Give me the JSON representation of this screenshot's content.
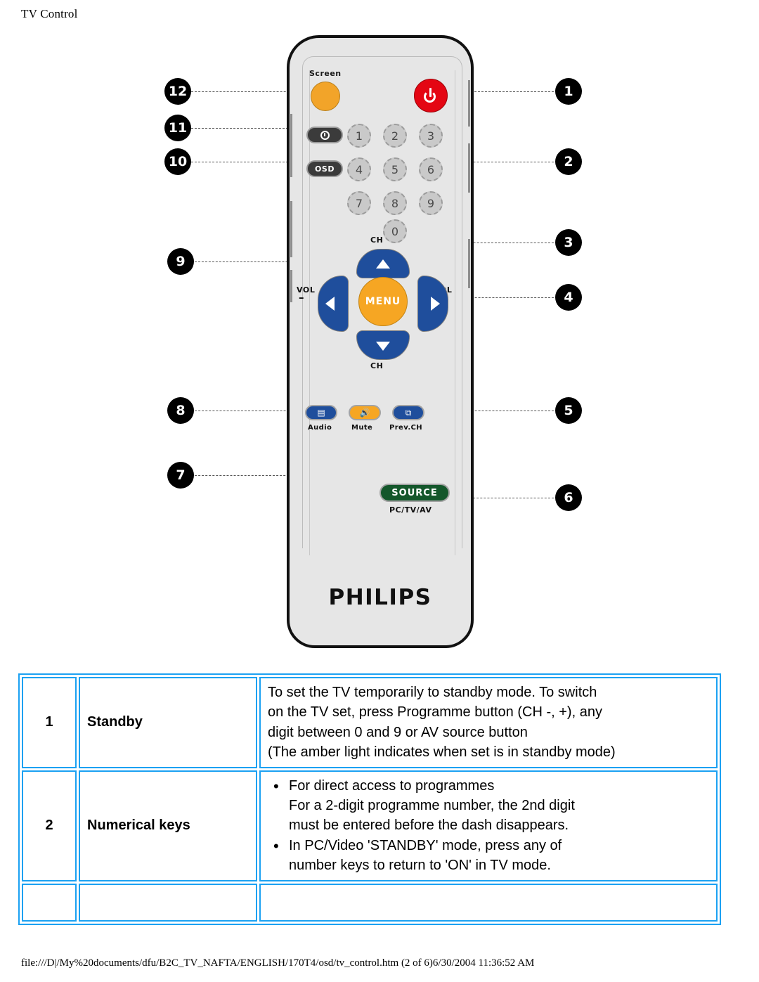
{
  "page": {
    "header": "TV Control",
    "footer": "file:///D|/My%20documents/dfu/B2C_TV_NAFTA/ENGLISH/170T4/osd/tv_control.htm (2 of 6)6/30/2004 11:36:52 AM"
  },
  "remote": {
    "brand": "PHILIPS",
    "screen_label": "Screen",
    "buttons": {
      "screen": "",
      "power": "",
      "sleep": "",
      "osd": "OSD",
      "menu": "MENU",
      "source": "SOURCE",
      "source_sub": "PC/TV/AV",
      "audio": "Audio",
      "mute": "Mute",
      "prev_ch": "Prev.CH"
    },
    "nav_labels": {
      "ch_top": "CH",
      "ch_bottom": "CH",
      "vol_minus": "VOL",
      "vol_minus_sign": "–",
      "vol_plus": "VOL",
      "vol_plus_sign": "+"
    },
    "numeric_keys": [
      "1",
      "2",
      "3",
      "4",
      "5",
      "6",
      "7",
      "8",
      "9",
      "0"
    ],
    "callouts_left": [
      "12",
      "11",
      "10",
      "9",
      "8",
      "7"
    ],
    "callouts_right": [
      "1",
      "2",
      "3",
      "4",
      "5",
      "6"
    ]
  },
  "table": {
    "rows": [
      {
        "number": "1",
        "name": "Standby",
        "description_lines": [
          "To set the TV temporarily to standby mode. To switch",
          "on the TV set, press Programme button (CH -, +), any",
          "digit between 0 and 9 or AV source button",
          "(The amber light indicates when set is in standby mode)"
        ]
      },
      {
        "number": "2",
        "name": "Numerical keys",
        "bullets": [
          {
            "main": "For direct access to programmes",
            "sub": [
              "For a 2-digit programme number, the 2nd digit",
              "must be entered before the dash disappears."
            ]
          },
          {
            "main": "In PC/Video 'STANDBY' mode, press any of",
            "sub": [
              "number keys to return to 'ON' in TV mode."
            ]
          }
        ]
      }
    ]
  },
  "colors": {
    "table_border": "#1ba1f2",
    "accent_orange": "#f6a623",
    "power_red": "#e40613",
    "nav_blue": "#1f4e9c",
    "source_green": "#14572b",
    "remote_body": "#e6e6e6"
  }
}
